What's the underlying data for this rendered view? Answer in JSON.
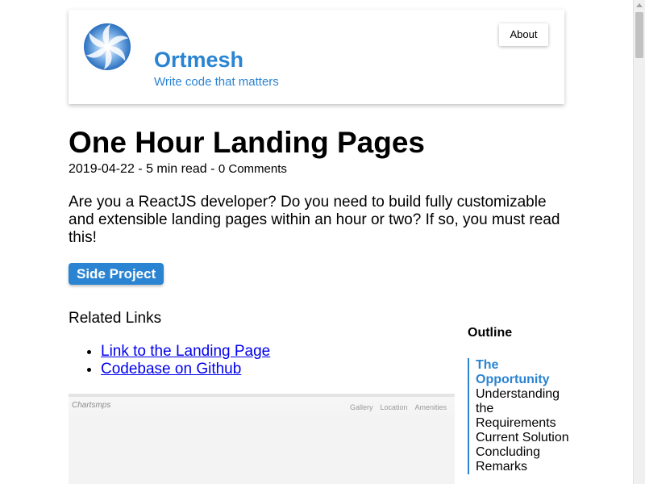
{
  "header": {
    "logo_icon": "pinwheel-logo-icon",
    "site_title": "Ortmesh",
    "tagline": "Write code that matters",
    "about_label": "About"
  },
  "post": {
    "title": "One Hour Landing Pages",
    "meta": "2019-04-22 - 5 min read - ",
    "comments_label": "0 Comments",
    "lead": "Are you a ReactJS developer? Do you need to build fully customizable and extensible landing pages within an hour or two? If so, you must read this!",
    "tag": "Side Project"
  },
  "related": {
    "heading": "Related Links",
    "links": [
      "Link to the Landing Page",
      "Codebase on Github"
    ]
  },
  "preview": {
    "logo_text": "Chartsmps",
    "nav": [
      "Gallery",
      "Location",
      "Amenities"
    ]
  },
  "outline": {
    "heading": "Outline",
    "items": [
      "The Opportunity",
      "Understanding the Requirements",
      "Current Solution",
      "Concluding Remarks"
    ]
  },
  "colors": {
    "accent": "#2a84d2",
    "link": "#0000ee"
  }
}
